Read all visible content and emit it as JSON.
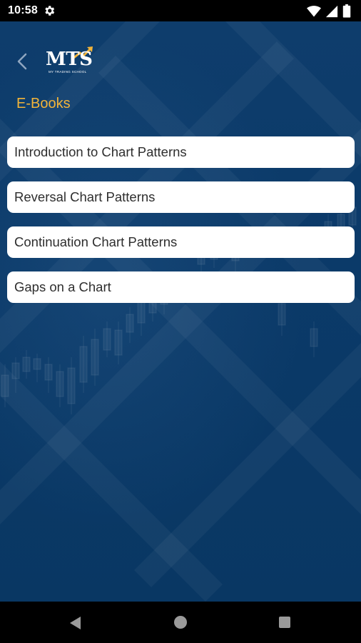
{
  "status_bar": {
    "time": "10:58",
    "icons": [
      "gear-icon",
      "wifi-icon",
      "signal-icon",
      "battery-icon"
    ]
  },
  "header": {
    "back_icon": "chevron-left-icon",
    "logo_text": "MTS",
    "logo_subtext": "MY TRADING SCHOOL"
  },
  "section": {
    "title": "E-Books"
  },
  "ebooks": [
    {
      "label": "Introduction to Chart Patterns"
    },
    {
      "label": "Reversal Chart Patterns"
    },
    {
      "label": "Continuation Chart Patterns"
    },
    {
      "label": "Gaps on a Chart"
    }
  ],
  "colors": {
    "background": "#0b3a6a",
    "accent": "#f2b43a",
    "card": "#ffffff",
    "card_text": "#2e2e2e"
  },
  "nav_bar": {
    "buttons": [
      "back-triangle-icon",
      "home-circle-icon",
      "recents-square-icon"
    ]
  }
}
